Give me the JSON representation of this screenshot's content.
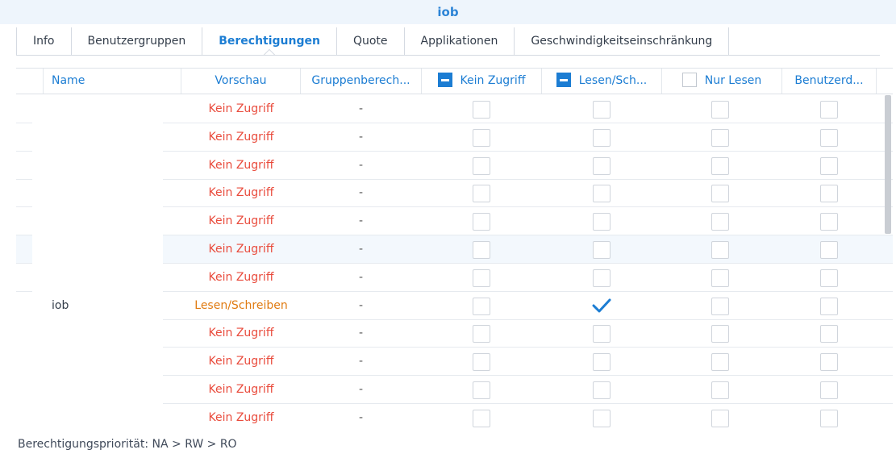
{
  "window": {
    "title": "iob"
  },
  "tabs": [
    {
      "label": "Info",
      "active": false
    },
    {
      "label": "Benutzergruppen",
      "active": false
    },
    {
      "label": "Berechtigungen",
      "active": true
    },
    {
      "label": "Quote",
      "active": false
    },
    {
      "label": "Applikationen",
      "active": false
    },
    {
      "label": "Geschwindigkeitseinschränkung",
      "active": false
    }
  ],
  "columns": {
    "name": "Name",
    "preview": "Vorschau",
    "group_permissions": "Gruppenberech...",
    "no_access": "Kein Zugriff",
    "read_write": "Lesen/Sch...",
    "read_only": "Nur Lesen",
    "custom": "Benutzerd..."
  },
  "header_checkboxes": {
    "no_access": "partial",
    "read_write": "partial",
    "read_only": "unchecked"
  },
  "rows": [
    {
      "name": "",
      "preview": "Kein Zugriff",
      "group": "-",
      "no_access": false,
      "read_write": false,
      "read_only": false,
      "custom": false
    },
    {
      "name": "",
      "preview": "Kein Zugriff",
      "group": "-",
      "no_access": false,
      "read_write": false,
      "read_only": false,
      "custom": false
    },
    {
      "name": "",
      "preview": "Kein Zugriff",
      "group": "-",
      "no_access": false,
      "read_write": false,
      "read_only": false,
      "custom": false
    },
    {
      "name": "",
      "preview": "Kein Zugriff",
      "group": "-",
      "no_access": false,
      "read_write": false,
      "read_only": false,
      "custom": false
    },
    {
      "name": "",
      "preview": "Kein Zugriff",
      "group": "-",
      "no_access": false,
      "read_write": false,
      "read_only": false,
      "custom": false
    },
    {
      "name": "",
      "preview": "Kein Zugriff",
      "group": "-",
      "no_access": false,
      "read_write": false,
      "read_only": false,
      "custom": false
    },
    {
      "name": "",
      "preview": "Kein Zugriff",
      "group": "-",
      "no_access": false,
      "read_write": false,
      "read_only": false,
      "custom": false
    },
    {
      "name": "iob",
      "preview": "Lesen/Schreiben",
      "group": "-",
      "no_access": false,
      "read_write": true,
      "read_only": false,
      "custom": false
    },
    {
      "name": "",
      "preview": "Kein Zugriff",
      "group": "-",
      "no_access": false,
      "read_write": false,
      "read_only": false,
      "custom": false
    },
    {
      "name": "",
      "preview": "Kein Zugriff",
      "group": "-",
      "no_access": false,
      "read_write": false,
      "read_only": false,
      "custom": false
    },
    {
      "name": "",
      "preview": "Kein Zugriff",
      "group": "-",
      "no_access": false,
      "read_write": false,
      "read_only": false,
      "custom": false
    },
    {
      "name": "",
      "preview": "Kein Zugriff",
      "group": "-",
      "no_access": false,
      "read_write": false,
      "read_only": false,
      "custom": false
    }
  ],
  "footer": {
    "priority": "Berechtigungspriorität: NA > RW > RO"
  },
  "colors": {
    "accent": "#1c7dd3",
    "no_access": "#e94b3c",
    "read_write": "#e07b12",
    "title_bg": "#eef5fc"
  }
}
